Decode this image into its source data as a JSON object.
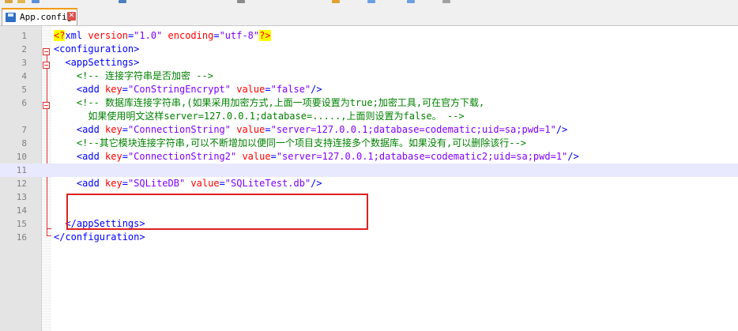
{
  "tab": {
    "label": "App.config",
    "close_glyph": "✕"
  },
  "icons": {
    "save": "save-icon",
    "close": "close-icon"
  },
  "colors": {
    "tag": "#0000ff",
    "attribute": "#ff0000",
    "value": "#8000ff",
    "comment": "#008000",
    "highlight_box": "#e02020",
    "tab_accent": "#f39c12"
  },
  "editor": {
    "lines": [
      {
        "n": "1",
        "tokens": [
          {
            "t": "pi",
            "v": "<?"
          },
          {
            "t": "tag",
            "v": "xml "
          },
          {
            "t": "attr",
            "v": "version"
          },
          {
            "t": "tag",
            "v": "="
          },
          {
            "t": "val",
            "v": "\"1.0\""
          },
          {
            "t": "attr",
            "v": " encoding"
          },
          {
            "t": "tag",
            "v": "="
          },
          {
            "t": "val",
            "v": "\"utf-8\""
          },
          {
            "t": "pi",
            "v": "?>"
          }
        ]
      },
      {
        "n": "2",
        "tokens": [
          {
            "t": "tag",
            "v": "<configuration>"
          }
        ]
      },
      {
        "n": "3",
        "tokens": [
          {
            "t": "tag",
            "v": "  <appSettings>"
          }
        ]
      },
      {
        "n": "4",
        "tokens": [
          {
            "t": "cmt",
            "v": "    <!-- 连接字符串是否加密 -->"
          }
        ]
      },
      {
        "n": "5",
        "tokens": [
          {
            "t": "tag",
            "v": "    <add "
          },
          {
            "t": "attr",
            "v": "key"
          },
          {
            "t": "tag",
            "v": "="
          },
          {
            "t": "val",
            "v": "\"ConStringEncrypt\""
          },
          {
            "t": "attr",
            "v": " value"
          },
          {
            "t": "tag",
            "v": "="
          },
          {
            "t": "val",
            "v": "\"false\""
          },
          {
            "t": "tag",
            "v": "/>"
          }
        ]
      },
      {
        "n": "6",
        "tokens": [
          {
            "t": "cmt",
            "v": "    <!-- 数据库连接字符串,(如果采用加密方式,上面一项要设置为true;加密工具,可在官方下载,"
          }
        ]
      },
      {
        "n": "",
        "tokens": [
          {
            "t": "cmt",
            "v": "      如果使用明文这样server=127.0.0.1;database=.....,上面则设置为false。 -->"
          }
        ]
      },
      {
        "n": "7",
        "tokens": [
          {
            "t": "tag",
            "v": "    <add "
          },
          {
            "t": "attr",
            "v": "key"
          },
          {
            "t": "tag",
            "v": "="
          },
          {
            "t": "val",
            "v": "\"ConnectionString\""
          },
          {
            "t": "attr",
            "v": " value"
          },
          {
            "t": "tag",
            "v": "="
          },
          {
            "t": "val",
            "v": "\"server=127.0.0.1;database=codematic;uid=sa;pwd=1\""
          },
          {
            "t": "tag",
            "v": "/>"
          }
        ]
      },
      {
        "n": "8",
        "tokens": [
          {
            "t": "cmt",
            "v": "    <!--其它模块连接字符串,可以不断增加以便同一个项目支持连接多个数据库。如果没有,可以删除该行-->"
          }
        ]
      },
      {
        "n": "10",
        "tokens": [
          {
            "t": "tag",
            "v": "    <add "
          },
          {
            "t": "attr",
            "v": "key"
          },
          {
            "t": "tag",
            "v": "="
          },
          {
            "t": "val",
            "v": "\"ConnectionString2\""
          },
          {
            "t": "attr",
            "v": " value"
          },
          {
            "t": "tag",
            "v": "="
          },
          {
            "t": "val",
            "v": "\"server=127.0.0.1;database=codematic2;uid=sa;pwd=1\""
          },
          {
            "t": "tag",
            "v": "/>"
          }
        ]
      },
      {
        "n": "11",
        "tokens": [],
        "current": true
      },
      {
        "n": "12",
        "tokens": [
          {
            "t": "tag",
            "v": "    <add "
          },
          {
            "t": "attr",
            "v": "key"
          },
          {
            "t": "tag",
            "v": "="
          },
          {
            "t": "val",
            "v": "\"SQLiteDB\""
          },
          {
            "t": "attr",
            "v": " value"
          },
          {
            "t": "tag",
            "v": "="
          },
          {
            "t": "val",
            "v": "\"SQLiteTest.db\""
          },
          {
            "t": "tag",
            "v": "/>"
          }
        ]
      },
      {
        "n": "13",
        "tokens": []
      },
      {
        "n": "14",
        "tokens": []
      },
      {
        "n": "15",
        "tokens": [
          {
            "t": "tag",
            "v": "  </appSettings>"
          }
        ]
      },
      {
        "n": "16",
        "tokens": [
          {
            "t": "tag",
            "v": "</configuration>"
          }
        ]
      }
    ]
  }
}
